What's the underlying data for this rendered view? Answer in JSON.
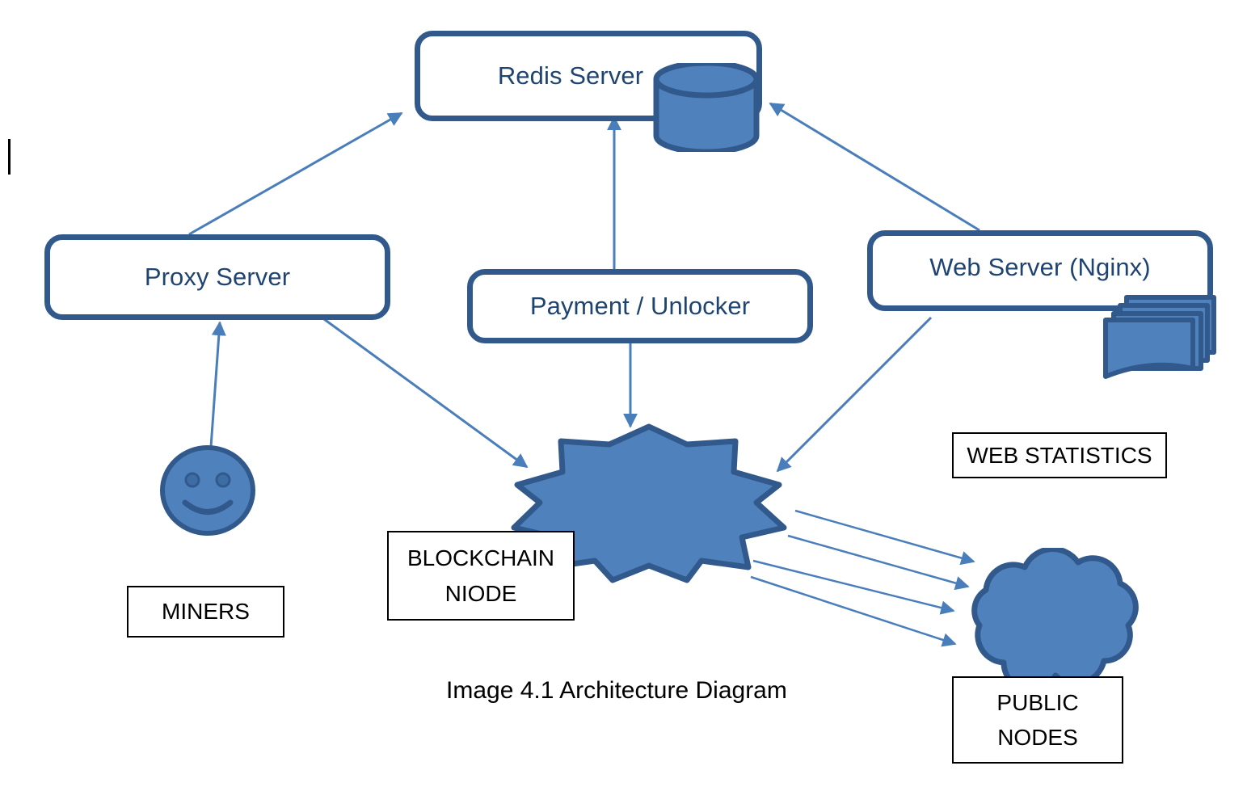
{
  "diagram": {
    "caption": "Image 4.1 Architecture Diagram",
    "colors": {
      "shape_fill": "#4F81BD",
      "shape_stroke": "#31598C",
      "connector": "#4A7EBB",
      "box_text": "#1F4471",
      "label_text": "#000000",
      "background": "#FFFFFF"
    },
    "nodes": {
      "redis_server": {
        "label": "Redis Server",
        "icon": "database-cylinder-icon"
      },
      "proxy_server": {
        "label": "Proxy Server"
      },
      "payment_unlocker": {
        "label": "Payment / Unlocker"
      },
      "web_server": {
        "label": "Web Server (Nginx)",
        "icon": "document-stack-icon"
      },
      "blockchain_node": {
        "label_line1": "BLOCKCHAIN",
        "label_line2": "NIODE",
        "icon": "starburst-icon"
      },
      "miners": {
        "label": "MINERS",
        "icon": "smiley-face-icon"
      },
      "public_nodes": {
        "label_line1": "PUBLIC",
        "label_line2": "NODES",
        "icon": "cloud-icon"
      },
      "web_statistics": {
        "label": "WEB STATISTICS"
      }
    },
    "connections": [
      {
        "from": "proxy_server",
        "to": "redis_server",
        "direction": "one-way"
      },
      {
        "from": "payment_unlocker",
        "to": "redis_server",
        "direction": "one-way"
      },
      {
        "from": "web_server",
        "to": "redis_server",
        "direction": "one-way"
      },
      {
        "from": "miners",
        "to": "proxy_server",
        "direction": "one-way"
      },
      {
        "from": "proxy_server",
        "to": "blockchain_node",
        "direction": "one-way"
      },
      {
        "from": "payment_unlocker",
        "to": "blockchain_node",
        "direction": "one-way"
      },
      {
        "from": "web_server",
        "to": "blockchain_node",
        "direction": "one-way"
      },
      {
        "from": "blockchain_node",
        "to": "public_nodes",
        "direction": "one-way",
        "count": 4
      }
    ]
  }
}
